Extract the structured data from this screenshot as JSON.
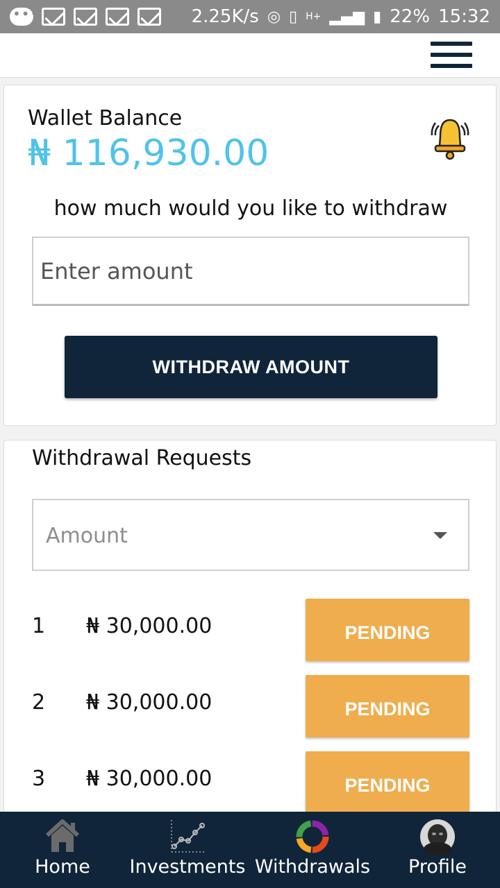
{
  "status_bar": {
    "speed": "2.25K/s",
    "network": "H+",
    "battery": "22%",
    "time": "15:32"
  },
  "wallet": {
    "label": "Wallet Balance",
    "amount": "₦ 116,930.00",
    "prompt": "how much would you like to withdraw",
    "input_placeholder": "Enter amount",
    "button_label": "WITHDRAW AMOUNT"
  },
  "requests": {
    "title": "Withdrawal Requests",
    "sort_select_value": "Amount",
    "rows": [
      {
        "index": "1",
        "amount": "₦ 30,000.00",
        "status": "PENDING"
      },
      {
        "index": "2",
        "amount": "₦ 30,000.00",
        "status": "PENDING"
      },
      {
        "index": "3",
        "amount": "₦ 30,000.00",
        "status": "PENDING"
      }
    ]
  },
  "nav": {
    "items": [
      {
        "label": "Home",
        "icon": "home-icon"
      },
      {
        "label": "Investments",
        "icon": "chart-line-icon"
      },
      {
        "label": "Withdrawals",
        "icon": "donut-icon"
      },
      {
        "label": "Profile",
        "icon": "avatar"
      }
    ]
  },
  "colors": {
    "primary": "#10253a",
    "balance": "#4fc3e8",
    "pending": "#efad4d",
    "statusbar": "#8a8a8a"
  }
}
